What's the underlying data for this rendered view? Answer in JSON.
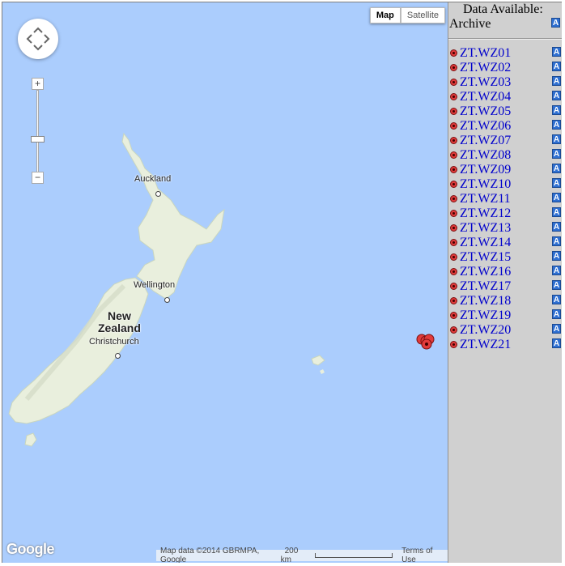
{
  "map": {
    "map_type_buttons": {
      "map": "Map",
      "satellite": "Satellite"
    },
    "zoom": {
      "plus": "+",
      "minus": "−"
    },
    "labels": {
      "auckland": "Auckland",
      "wellington": "Wellington",
      "christchurch": "Christchurch",
      "new_zealand_line1": "New",
      "new_zealand_line2": "Zealand"
    },
    "google_logo": "Google",
    "attribution": "Map data ©2014 GBRMPA, Google",
    "scale": "200 km",
    "terms": "Terms of Use",
    "colors": {
      "water": "#abcdfd",
      "land": "#e9efdd",
      "marker": "#e23b3b"
    }
  },
  "sidebar": {
    "title": "Data Available:",
    "subtitle": "Archive",
    "icon_letter": "A",
    "stations": [
      "ZT.WZ01",
      "ZT.WZ02",
      "ZT.WZ03",
      "ZT.WZ04",
      "ZT.WZ05",
      "ZT.WZ06",
      "ZT.WZ07",
      "ZT.WZ08",
      "ZT.WZ09",
      "ZT.WZ10",
      "ZT.WZ11",
      "ZT.WZ12",
      "ZT.WZ13",
      "ZT.WZ14",
      "ZT.WZ15",
      "ZT.WZ16",
      "ZT.WZ17",
      "ZT.WZ18",
      "ZT.WZ19",
      "ZT.WZ20",
      "ZT.WZ21"
    ]
  }
}
